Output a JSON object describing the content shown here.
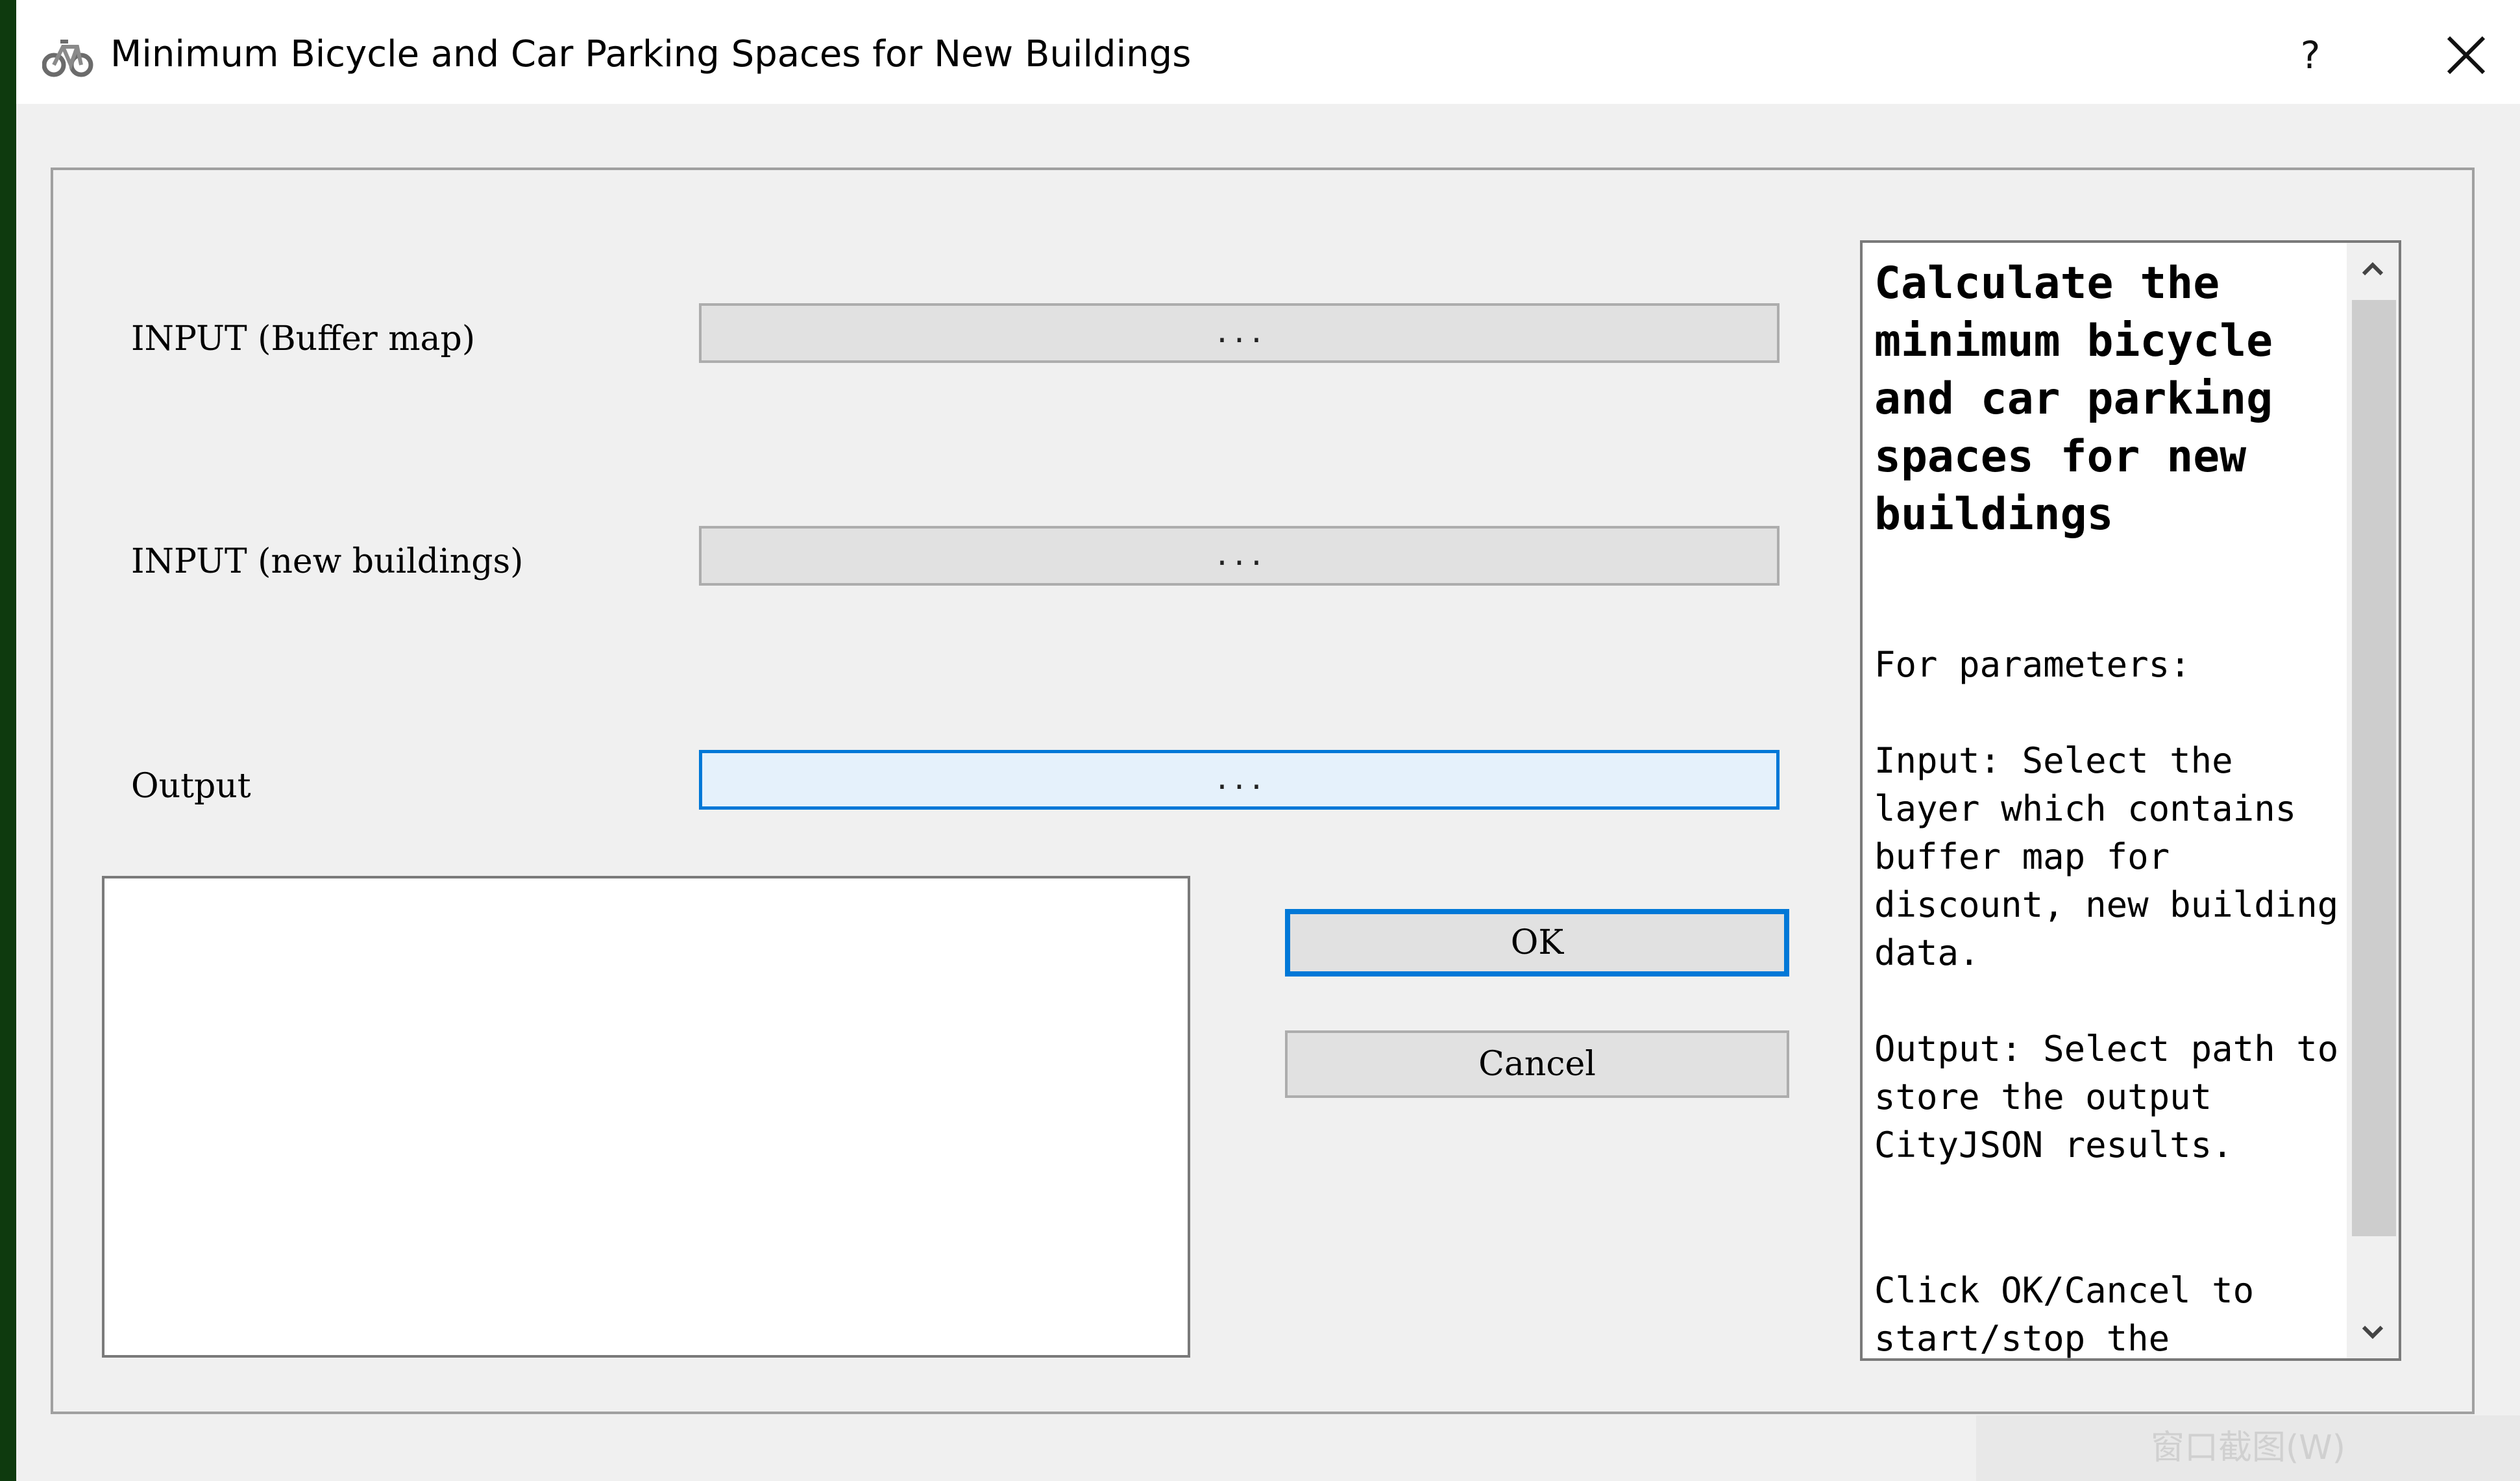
{
  "window": {
    "title": "Minimum Bicycle and Car Parking Spaces for New Buildings",
    "help_label": "?",
    "app_icon": "bicycle-icon",
    "close_icon": "close-icon"
  },
  "form": {
    "fields": [
      {
        "label": "INPUT (Buffer map)",
        "button_text": "..."
      },
      {
        "label": "INPUT (new buildings)",
        "button_text": "..."
      },
      {
        "label": "Output",
        "button_text": "..."
      }
    ]
  },
  "buttons": {
    "ok": "OK",
    "cancel": "Cancel"
  },
  "help": {
    "heading": "Calculate the minimum bicycle and car parking spaces for new buildings",
    "params_title": "For parameters:",
    "input_text": "Input: Select the layer which contains buffer map for discount, new building data.",
    "output_text": "Output: Select path to store the output CityJSON results.",
    "click_text": "Click OK/Cancel to start/stop the"
  },
  "overlay": {
    "watermark": "窗口截图(W)"
  },
  "colors": {
    "accent": "#0078d7",
    "window_bg": "#f0f0f0",
    "desktop_bg": "#0e3a0e"
  }
}
